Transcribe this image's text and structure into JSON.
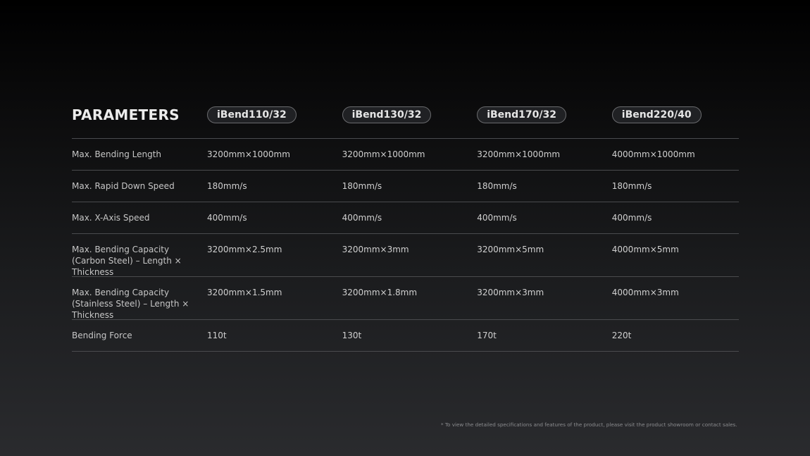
{
  "table": {
    "title": "PARAMETERS",
    "models": [
      "iBend110/32",
      "iBend130/32",
      "iBend170/32",
      "iBend220/40"
    ],
    "rows": [
      {
        "label": "Max. Bending Length",
        "values": [
          "3200mm×1000mm",
          "3200mm×1000mm",
          "3200mm×1000mm",
          "4000mm×1000mm"
        ]
      },
      {
        "label": "Max. Rapid Down Speed",
        "values": [
          "180mm/s",
          "180mm/s",
          "180mm/s",
          "180mm/s"
        ]
      },
      {
        "label": "Max. X-Axis Speed",
        "values": [
          "400mm/s",
          "400mm/s",
          "400mm/s",
          "400mm/s"
        ]
      },
      {
        "label": "Max. Bending Capacity (Carbon Steel) – Length × Thickness",
        "values": [
          "3200mm×2.5mm",
          "3200mm×3mm",
          "3200mm×5mm",
          "4000mm×5mm"
        ]
      },
      {
        "label": "Max. Bending Capacity (Stainless Steel) – Length × Thickness",
        "values": [
          "3200mm×1.5mm",
          "3200mm×1.8mm",
          "3200mm×3mm",
          "4000mm×3mm"
        ]
      },
      {
        "label": "Bending Force",
        "values": [
          "110t",
          "130t",
          "170t",
          "220t"
        ]
      }
    ]
  },
  "footnote": "* To view the detailed specifications and features of the product, please visit the product showroom or contact sales."
}
